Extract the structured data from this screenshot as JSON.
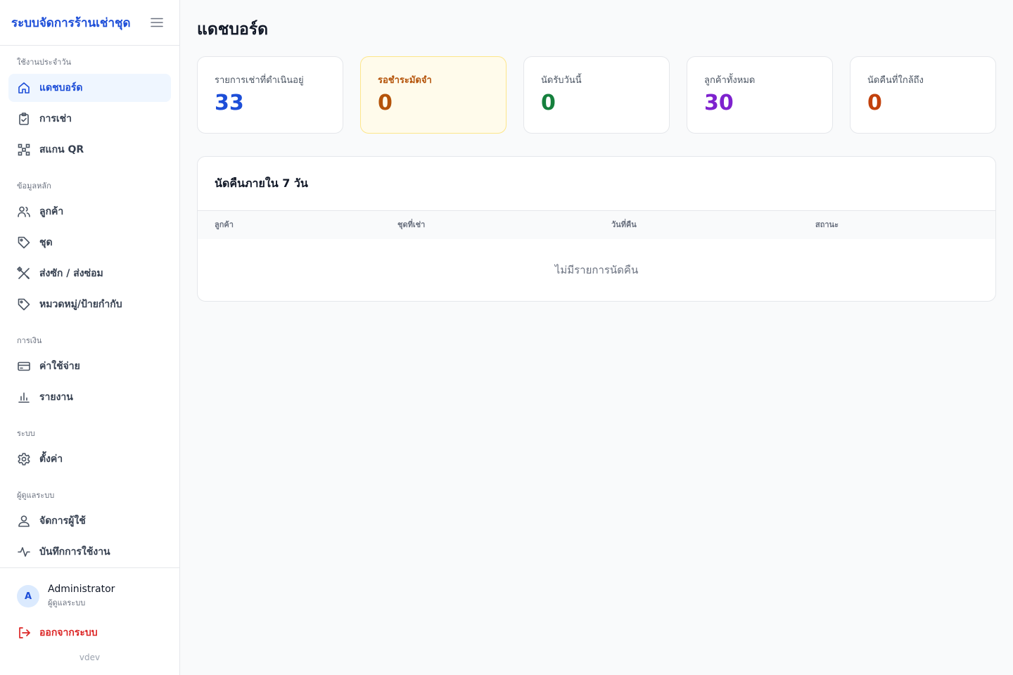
{
  "sidebar": {
    "brand": "ระบบจัดการร้านเช่าชุด",
    "sections": {
      "daily": {
        "label": "ใช้งานประจำวัน",
        "items": {
          "dashboard": "แดชบอร์ด",
          "rentals": "การเช่า",
          "scan_qr": "สแกน QR"
        }
      },
      "master": {
        "label": "ข้อมูลหลัก",
        "items": {
          "customers": "ลูกค้า",
          "outfits": "ชุด",
          "laundry": "ส่งซัก / ส่งซ่อม",
          "categories": "หมวดหมู่/ป้ายกำกับ"
        }
      },
      "finance": {
        "label": "การเงิน",
        "items": {
          "expenses": "ค่าใช้จ่าย",
          "reports": "รายงาน"
        }
      },
      "system": {
        "label": "ระบบ",
        "items": {
          "settings": "ตั้งค่า"
        }
      },
      "admin": {
        "label": "ผู้ดูแลระบบ",
        "items": {
          "users": "จัดการผู้ใช้",
          "activity_log": "บันทึกการใช้งาน"
        }
      }
    },
    "user": {
      "initial": "A",
      "name": "Administrator",
      "role": "ผู้ดูแลระบบ"
    },
    "logout": "ออกจากระบบ",
    "version": "vdev"
  },
  "page": {
    "title": "แดชบอร์ด"
  },
  "stats": [
    {
      "label": "รายการเช่าที่ดำเนินอยู่",
      "value": "33",
      "color": "#1d4ed8"
    },
    {
      "label": "รอชำระมัดจำ",
      "value": "0",
      "color": "#b45309"
    },
    {
      "label": "นัดรับวันนี้",
      "value": "0",
      "color": "#15803d"
    },
    {
      "label": "ลูกค้าทั้งหมด",
      "value": "30",
      "color": "#7e22ce"
    },
    {
      "label": "นัดคืนที่ใกล้ถึง",
      "value": "0",
      "color": "#c2410c"
    }
  ],
  "returns_panel": {
    "title": "นัดคืนภายใน 7 วัน",
    "columns": {
      "customer": "ลูกค้า",
      "outfit": "ชุดที่เช่า",
      "return_date": "วันที่คืน",
      "status": "สถานะ"
    },
    "empty_text": "ไม่มีรายการนัดคืน"
  },
  "colors": {
    "accent": "#1d4ed8",
    "danger": "#dc2626",
    "active_bg": "#eff6ff"
  }
}
